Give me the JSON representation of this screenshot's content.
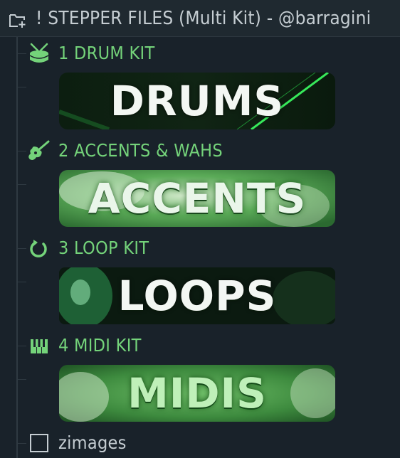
{
  "header": {
    "title": "! STEPPER FILES (Multi Kit) - @barragini",
    "icon": "folder-plus-icon"
  },
  "items": [
    {
      "label": "1 DRUM KIT",
      "icon": "drum-icon",
      "banner_text": "DRUMS"
    },
    {
      "label": "2 ACCENTS & WAHS",
      "icon": "guitar-icon",
      "banner_text": "ACCENTS"
    },
    {
      "label": "3 LOOP KIT",
      "icon": "loop-icon",
      "banner_text": "LOOPS"
    },
    {
      "label": "4 MIDI KIT",
      "icon": "piano-keys-icon",
      "banner_text": "MIDIS"
    },
    {
      "label": "zimages",
      "icon": "empty-square-icon"
    }
  ],
  "colors": {
    "accent": "#74d37a",
    "background": "#19222a",
    "header_bg": "#1f2930",
    "text": "#c5cdd2"
  }
}
